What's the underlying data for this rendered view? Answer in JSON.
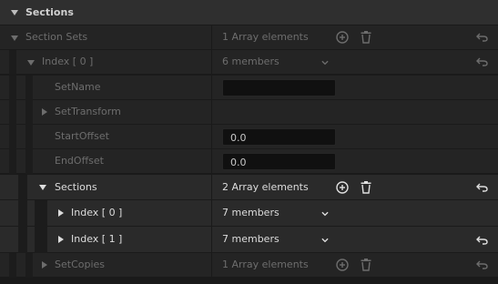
{
  "category": {
    "title": "Sections"
  },
  "section_sets": {
    "label": "Section Sets",
    "value": "1 Array elements"
  },
  "index0_outer": {
    "label": "Index [ 0 ]",
    "value": "6 members"
  },
  "set_name": {
    "label": "SetName",
    "value": ""
  },
  "set_transform": {
    "label": "SetTransform"
  },
  "start_offset": {
    "label": "StartOffset",
    "value": "0.0"
  },
  "end_offset": {
    "label": "EndOffset",
    "value": "0.0"
  },
  "sections": {
    "label": "Sections",
    "value": "2 Array elements"
  },
  "sections_index0": {
    "label": "Index [ 0 ]",
    "value": "7 members"
  },
  "sections_index1": {
    "label": "Index [ 1 ]",
    "value": "7 members"
  },
  "set_copies": {
    "label": "SetCopies",
    "value": "1 Array elements"
  },
  "icons": {
    "expand": "triangle-down-icon",
    "collapse": "triangle-right-icon",
    "add": "plus-circle-icon",
    "delete": "trash-icon",
    "dropdown": "chevron-down-icon",
    "reset": "reset-arrow-icon"
  },
  "colors": {
    "background": "#1a1a1a",
    "row": "#242424",
    "header": "#2f2f2f",
    "input": "#101010",
    "text": "#c8c8c8",
    "muted": "#6d6d6d"
  }
}
